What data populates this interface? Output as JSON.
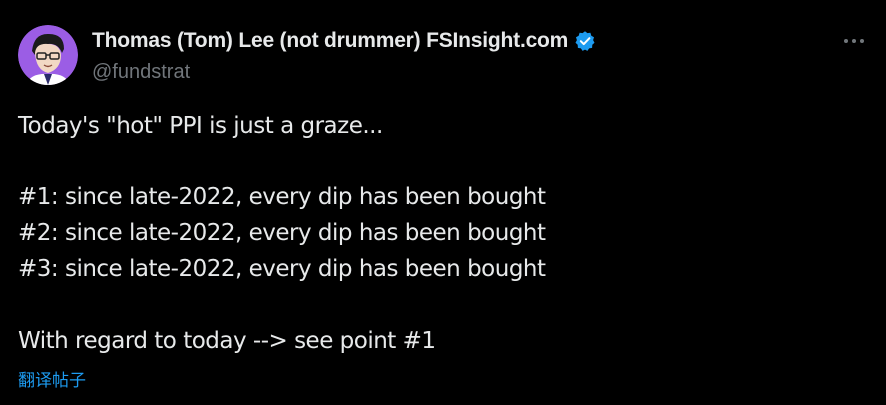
{
  "author": {
    "display_name": "Thomas (Tom) Lee (not drummer) FSInsight.com",
    "handle": "@fundstrat",
    "verified_icon": "verified-badge-icon",
    "avatar_icon": "avatar-cartoon-icon"
  },
  "menu": {
    "icon": "more-options-icon"
  },
  "tweet": {
    "lines": [
      "Today's \"hot\" PPI is just a graze...",
      "#1: since late-2022, every dip has been bought",
      "#2: since late-2022, every dip has been bought",
      "#3: since late-2022, every dip has been bought",
      "With regard to today --> see point #1"
    ],
    "translate_label": "翻译帖子"
  },
  "colors": {
    "background": "#000000",
    "text_primary": "#e7e9ea",
    "text_secondary": "#71767b",
    "accent": "#1d9bf0"
  }
}
